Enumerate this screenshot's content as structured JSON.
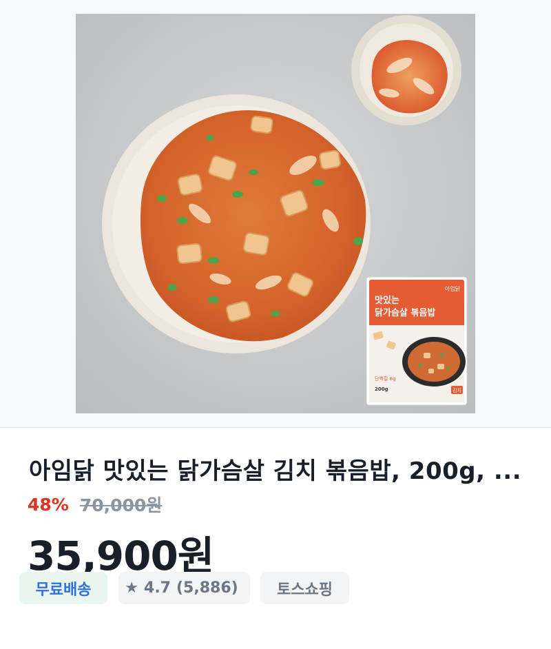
{
  "product": {
    "title": "아임닭 맛있는 닭가슴살 김치 볶음밥, 200g, ...",
    "discount": "48%",
    "original_price": "70,000원",
    "price": "35,900원"
  },
  "package": {
    "brand": "아임닭",
    "name_line1": "맛있는",
    "name_line2": "닭가슴살 볶음밥",
    "flavor": "김치",
    "weight": "200g",
    "protein": "단백질 8g"
  },
  "badges": {
    "shipping": "무료배송",
    "star_icon": "star-icon",
    "rating": "4.7",
    "review_count": "(5,886)",
    "seller": "토스쇼핑"
  },
  "colors": {
    "discount": "#e0301e",
    "shipping_text": "#2f6fe0",
    "shipping_bg": "#e8f6ef",
    "badge_bg": "#f2f4f6"
  }
}
